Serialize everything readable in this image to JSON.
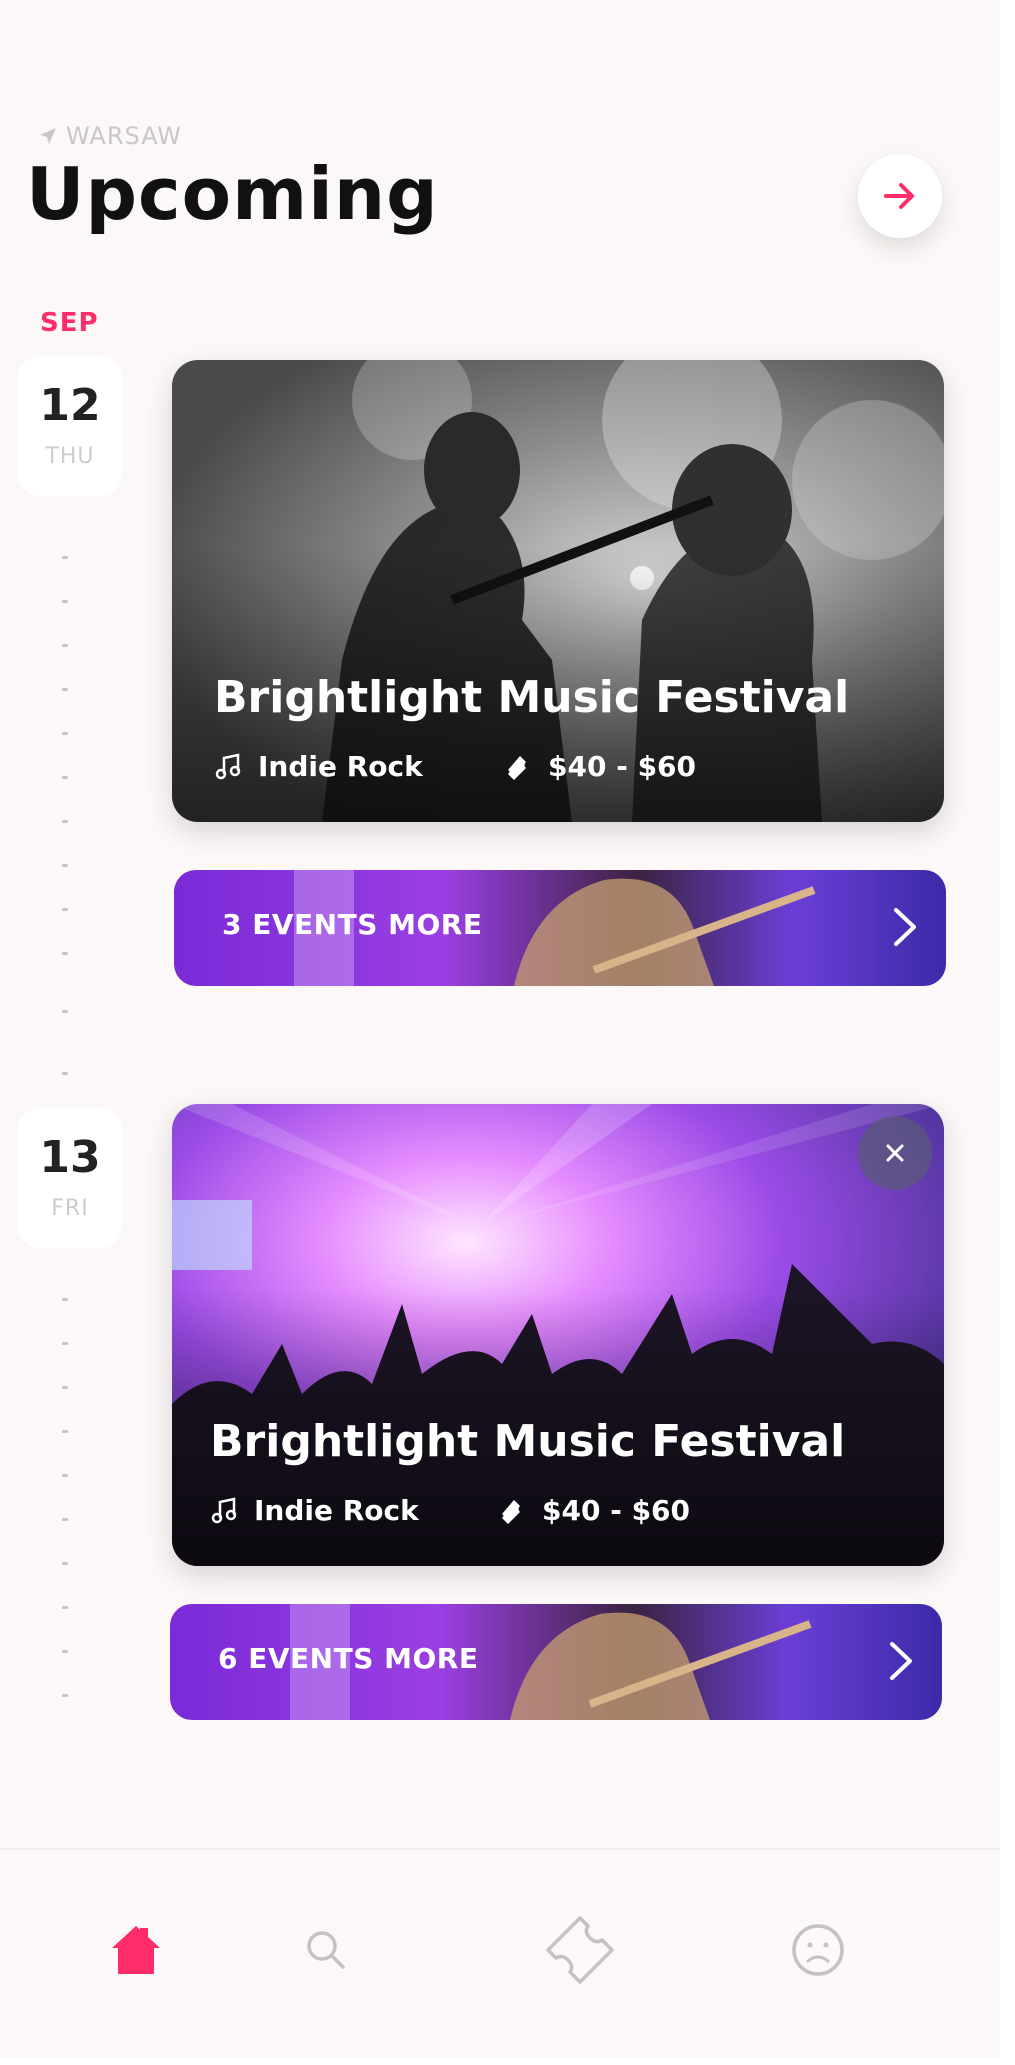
{
  "header": {
    "location": "WARSAW",
    "title": "Upcoming"
  },
  "schedule": {
    "month": "SEP",
    "days": [
      {
        "day_number": "12",
        "day_name": "THU",
        "event": {
          "title": "Brightlight Music Festival",
          "genre": "Indie Rock",
          "price_range": "$40 - $60"
        },
        "more_events_label": "3 EVENTS MORE"
      },
      {
        "day_number": "13",
        "day_name": "FRI",
        "event": {
          "title": "Brightlight Music Festival",
          "genre": "Indie Rock",
          "price_range": "$40 - $60"
        },
        "more_events_label": "6 EVENTS MORE"
      }
    ]
  },
  "bottom_nav": {
    "items": [
      {
        "icon": "home-icon",
        "active": true
      },
      {
        "icon": "search-icon",
        "active": false
      },
      {
        "icon": "ticket-icon",
        "active": false
      },
      {
        "icon": "profile-icon",
        "active": false
      }
    ]
  },
  "colors": {
    "accent": "#ff2c6a",
    "background": "#fcf8f7",
    "inactive_icon": "#c4c0c6"
  }
}
